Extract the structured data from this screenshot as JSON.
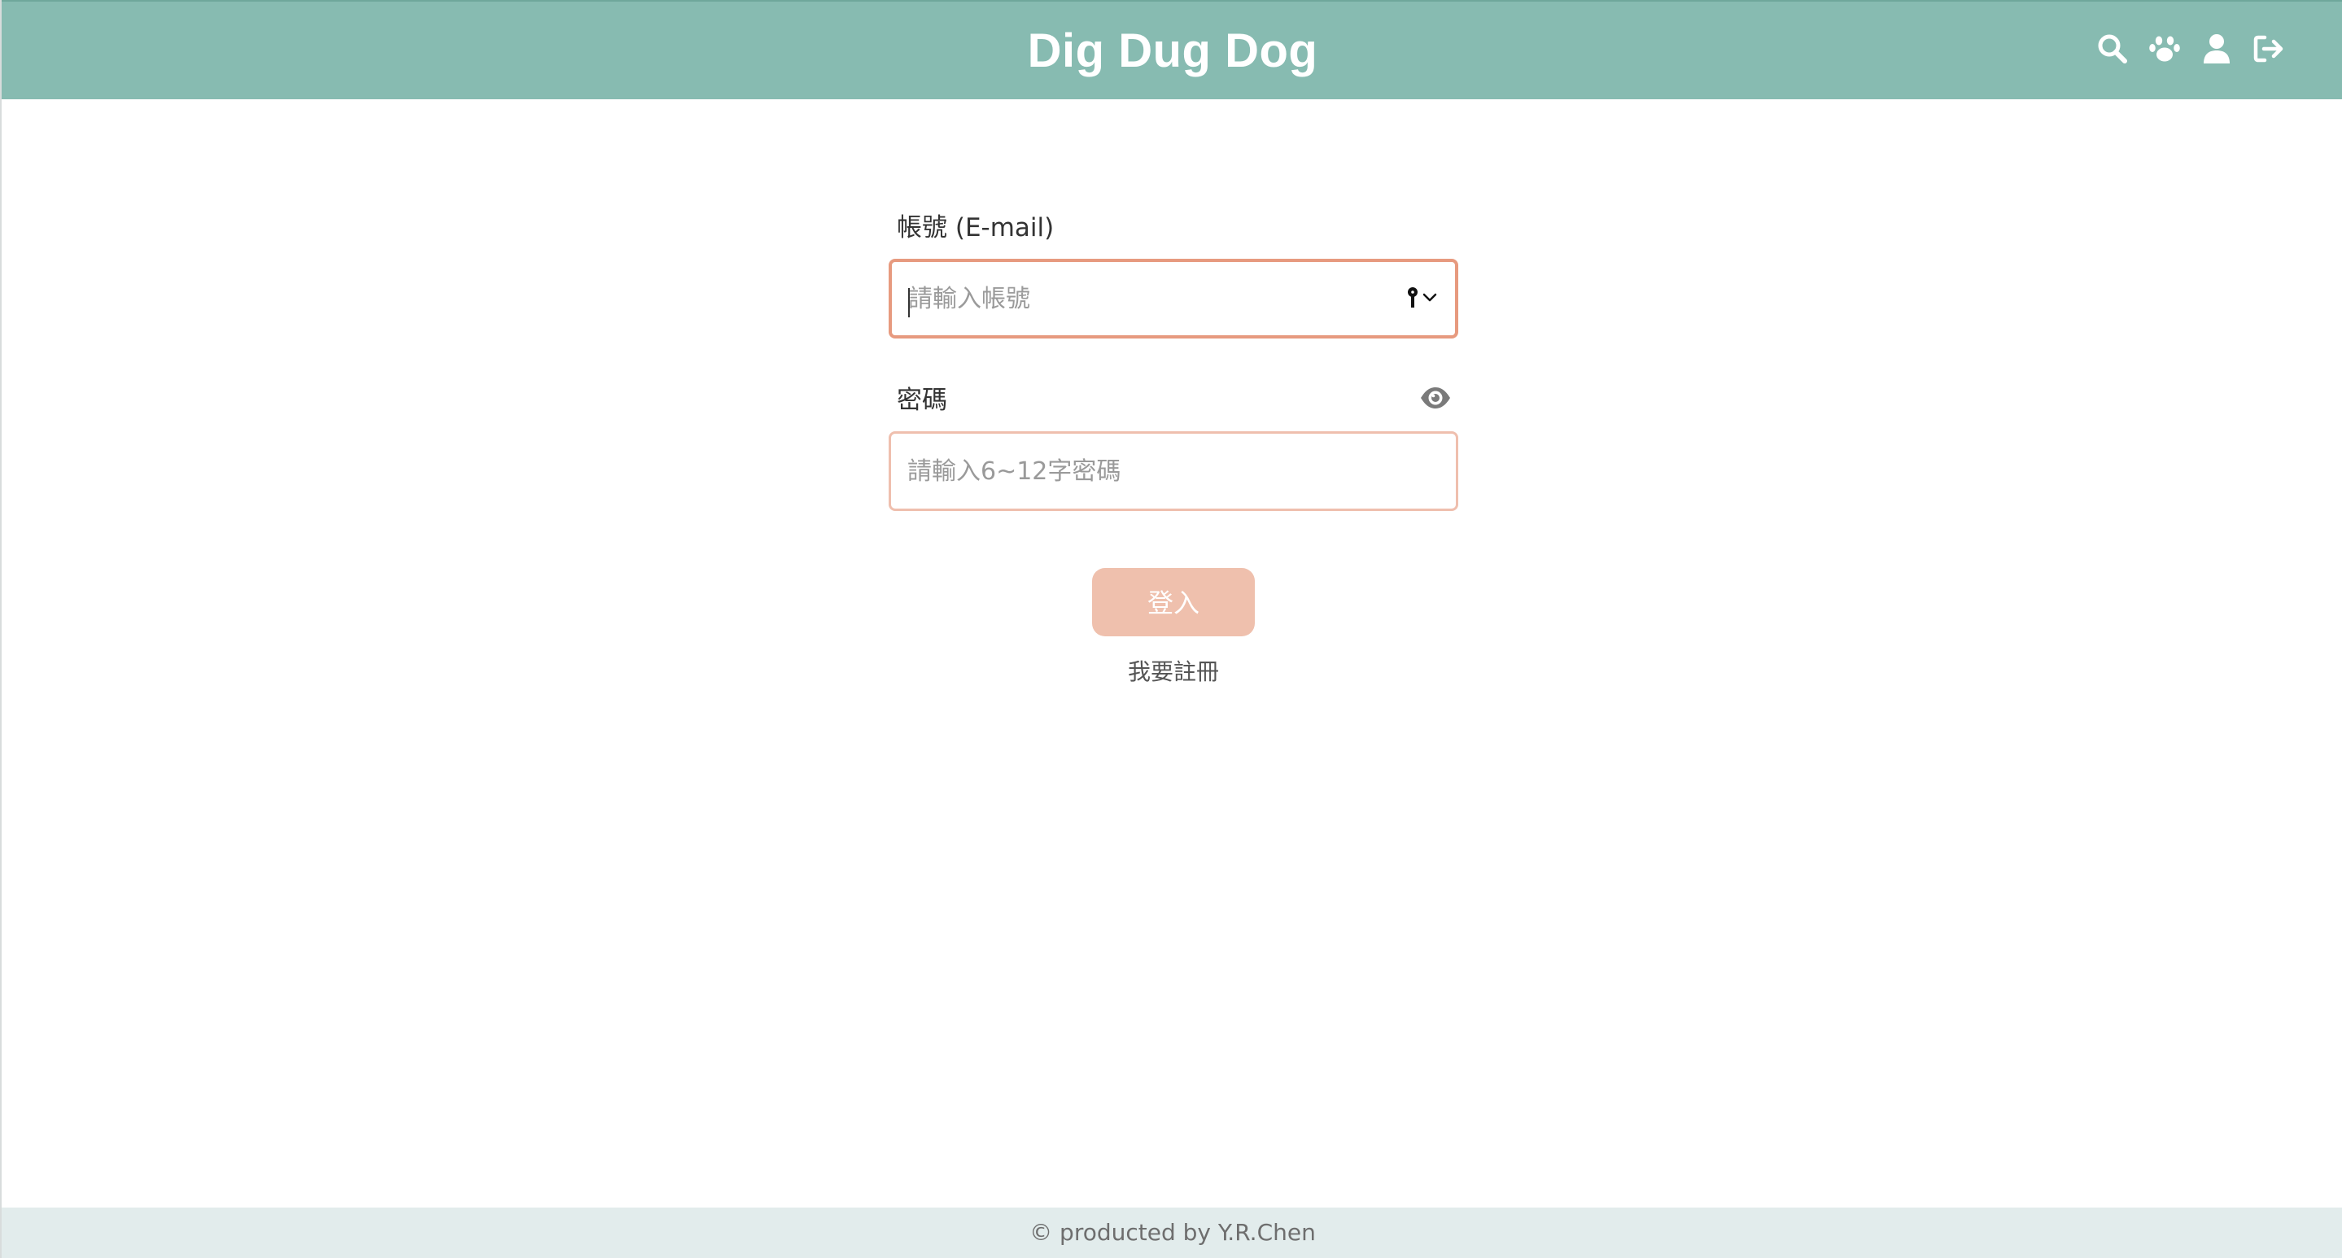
{
  "header": {
    "title": "Dig Dug Dog",
    "bg_color": "#87bbb1",
    "icons": [
      {
        "name": "search-icon"
      },
      {
        "name": "paw-icon"
      },
      {
        "name": "user-icon"
      },
      {
        "name": "logout-icon"
      }
    ]
  },
  "form": {
    "account": {
      "label": "帳號 (E-mail)",
      "placeholder": "請輸入帳號",
      "value": "",
      "focused": true,
      "accessory_icon": "key-icon"
    },
    "password": {
      "label": "密碼",
      "placeholder": "請輸入6~12字密碼",
      "value": "",
      "toggle_icon": "eye-icon"
    },
    "login_label": "登入",
    "register_label": "我要註冊",
    "accent_color": "#efc0ad",
    "focus_border_color": "#e79a7f"
  },
  "footer": {
    "text": "© producted by Y.R.Chen"
  }
}
